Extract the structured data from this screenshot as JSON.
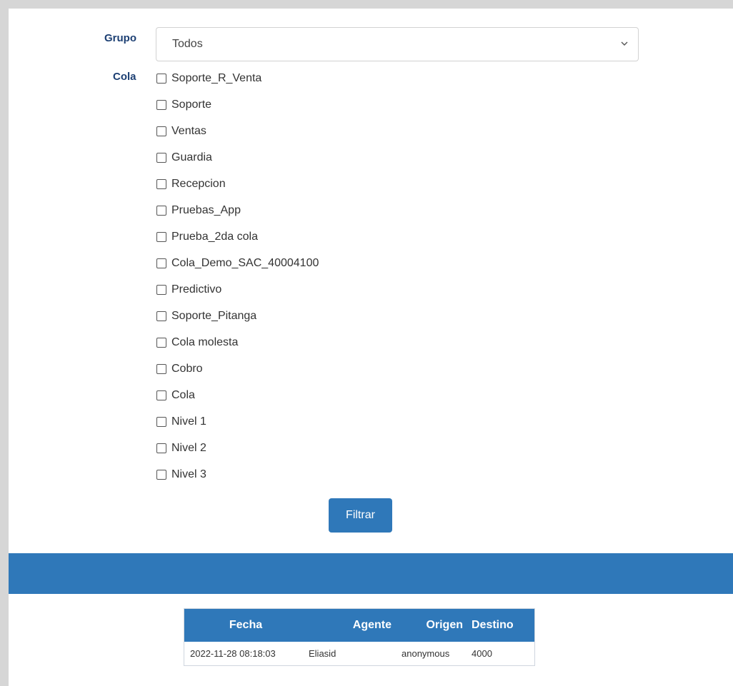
{
  "filters": {
    "grupo_label": "Grupo",
    "grupo_selected": "Todos",
    "cola_label": "Cola",
    "colas": [
      "Soporte_R_Venta",
      "Soporte",
      "Ventas",
      "Guardia",
      "Recepcion",
      "Pruebas_App",
      "Prueba_2da cola",
      "Cola_Demo_SAC_40004100",
      "Predictivo",
      "Soporte_Pitanga",
      "Cola molesta",
      "Cobro",
      "Cola",
      "Nivel 1",
      "Nivel 2",
      "Nivel 3"
    ],
    "filter_button": "Filtrar"
  },
  "table": {
    "headers": [
      "Fecha",
      "Agente",
      "Origen",
      "Destino"
    ],
    "rows": [
      [
        "2022-11-28 08:18:03",
        "Eliasid",
        "anonymous",
        "4000"
      ]
    ]
  },
  "colors": {
    "accent": "#2f78b9",
    "label": "#1c3f73"
  },
  "icons": {
    "select_chevron": "chevron-down-icon"
  }
}
